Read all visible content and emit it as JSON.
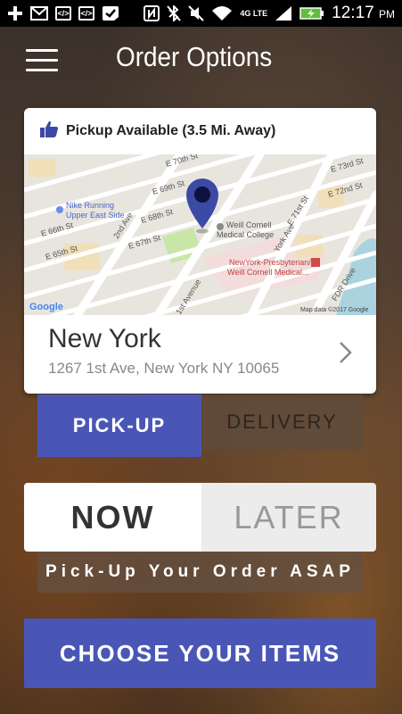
{
  "status_bar": {
    "time": "12:17",
    "ampm": "PM",
    "network": "4G LTE",
    "icons": [
      "add-icon",
      "gmail-icon",
      "code-icon",
      "code-icon",
      "check-icon",
      "nfc-icon",
      "bluetooth-off-icon",
      "mute-icon",
      "wifi-icon",
      "signal-icon",
      "battery-icon"
    ]
  },
  "header": {
    "title": "Order Options",
    "menu_icon": "hamburger-menu-icon"
  },
  "location_card": {
    "availability": "Pickup Available (3.5 Mi. Away)",
    "availability_icon": "thumbs-up-icon",
    "city": "New York",
    "address": "1267 1st Ave, New York NY 10065",
    "map": {
      "streets": [
        "E 70th St",
        "E 69th St",
        "E 68th St",
        "E 67th St",
        "E 66th St",
        "E 65th St",
        "E 73rd St",
        "E 72nd St",
        "E 71st St",
        "E 66th St",
        "E 65th St",
        "2nd Ave",
        "1st Avenue",
        "York Ave",
        "FDR Drive"
      ],
      "places": [
        "Nike Running Upper East Side",
        "Weill Cornell Medical College",
        "NewYork-Presbyterian/ Weill Cornell Medical..."
      ],
      "attribution": "Map data ©2017 Google",
      "logo": "Google"
    }
  },
  "order_type": {
    "pickup_label": "PICK-UP",
    "delivery_label": "DELIVERY",
    "selected": "pickup"
  },
  "timing": {
    "now_label": "NOW",
    "later_label": "LATER",
    "selected": "now",
    "message": "Pick-Up Your Order ASAP"
  },
  "cta_label": "CHOOSE YOUR ITEMS",
  "colors": {
    "accent": "#4a56b6",
    "map_pin": "#3b4aa3"
  }
}
